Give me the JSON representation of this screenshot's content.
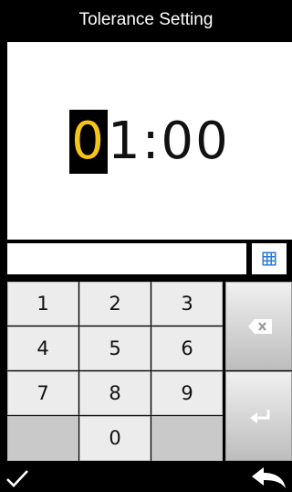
{
  "header": {
    "title": "Tolerance Setting"
  },
  "display": {
    "cursor_digit": "0",
    "rest_value": "1:00"
  },
  "input": {
    "value": ""
  },
  "keypad": {
    "keys": [
      "1",
      "2",
      "3",
      "4",
      "5",
      "6",
      "7",
      "8",
      "9",
      "0"
    ]
  },
  "icons": {
    "grid": "grid-icon",
    "backspace": "backspace-icon",
    "enter": "enter-icon",
    "confirm": "checkmark-icon",
    "back": "back-arrow-icon"
  },
  "colors": {
    "cursor": "#f5c518",
    "grid_icon": "#2a7ad6"
  }
}
